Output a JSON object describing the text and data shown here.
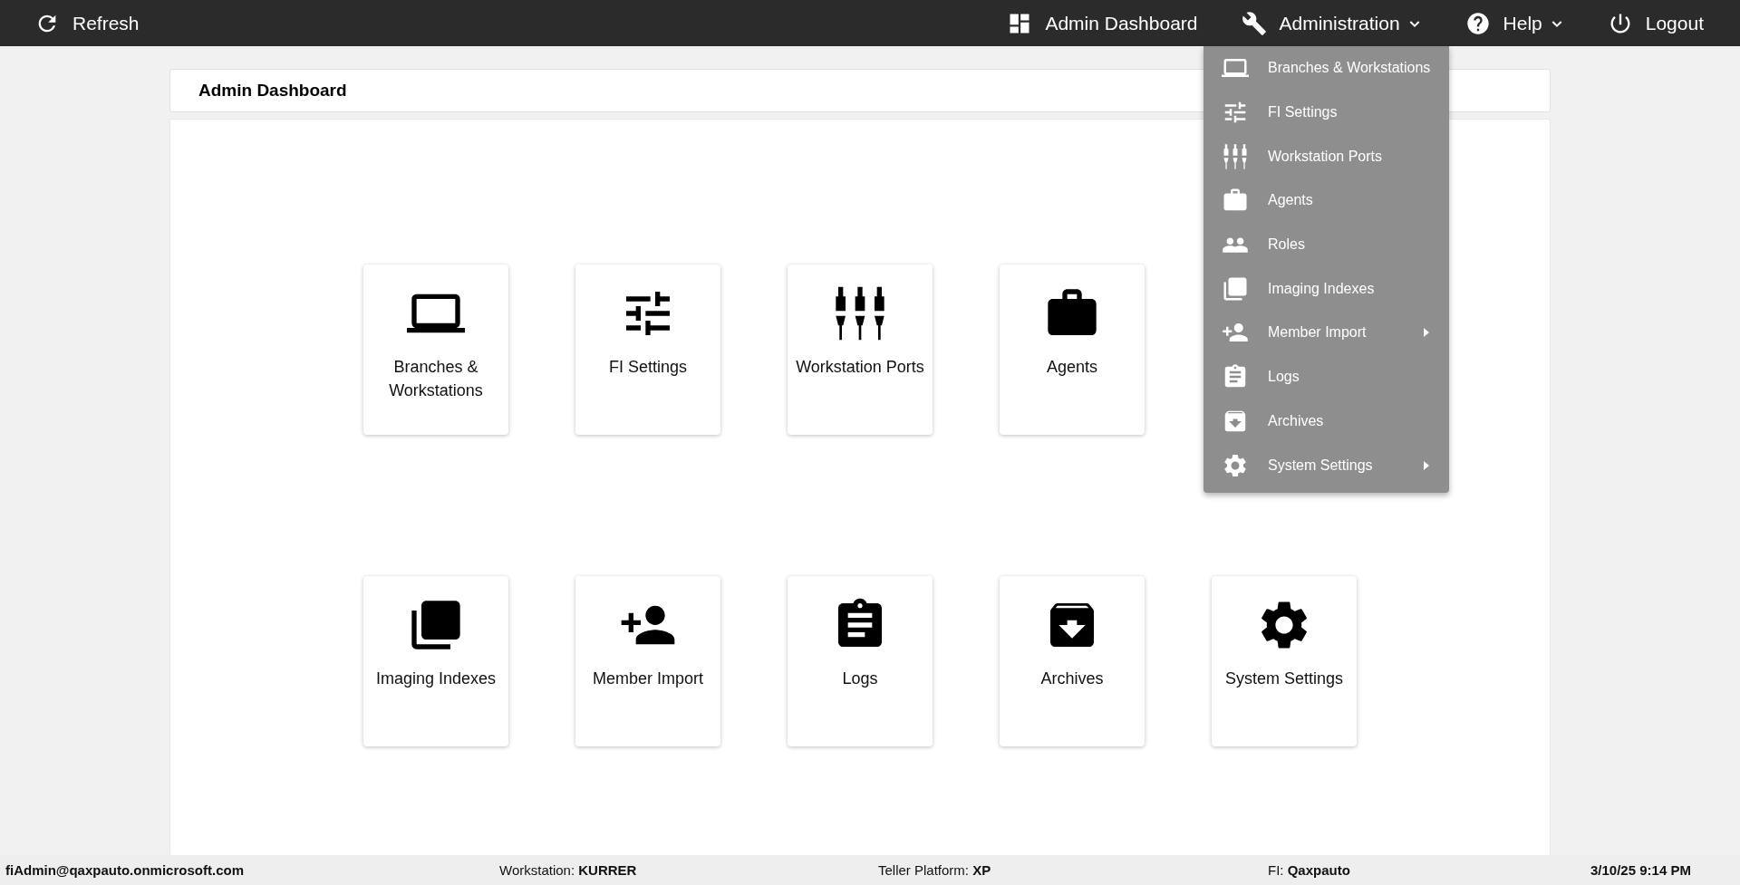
{
  "top_bar": {
    "refresh": "Refresh",
    "nav": [
      {
        "label": "Admin Dashboard",
        "has_dropdown": false
      },
      {
        "label": "Administration",
        "has_dropdown": true
      },
      {
        "label": "Help",
        "has_dropdown": true
      },
      {
        "label": "Logout",
        "has_dropdown": false
      }
    ]
  },
  "page_title": "Admin Dashboard",
  "card_rows": [
    [
      {
        "label": "Branches & Workstations"
      },
      {
        "label": "FI Settings"
      },
      {
        "label": "Workstation Ports"
      },
      {
        "label": "Agents"
      }
    ],
    [
      {
        "label": "Imaging Indexes"
      },
      {
        "label": "Member Import"
      },
      {
        "label": "Logs"
      },
      {
        "label": "Archives"
      },
      {
        "label": "System Settings"
      }
    ]
  ],
  "administration_menu": [
    {
      "label": "Branches & Workstations",
      "has_submenu": false
    },
    {
      "label": "FI Settings",
      "has_submenu": false
    },
    {
      "label": "Workstation Ports",
      "has_submenu": false
    },
    {
      "label": "Agents",
      "has_submenu": false
    },
    {
      "label": "Roles",
      "has_submenu": false
    },
    {
      "label": "Imaging Indexes",
      "has_submenu": false
    },
    {
      "label": "Member Import",
      "has_submenu": true
    },
    {
      "label": "Logs",
      "has_submenu": false
    },
    {
      "label": "Archives",
      "has_submenu": false
    },
    {
      "label": "System Settings",
      "has_submenu": true
    }
  ],
  "status_bar": {
    "user": "fiAdmin@qaxpauto.onmicrosoft.com",
    "workstation": "Workstation: **KURRER**",
    "platform": "Teller Platform: **XP**",
    "fi": "FI: **Qaxpauto**",
    "datetime": "3/10/25 9:14 PM"
  }
}
